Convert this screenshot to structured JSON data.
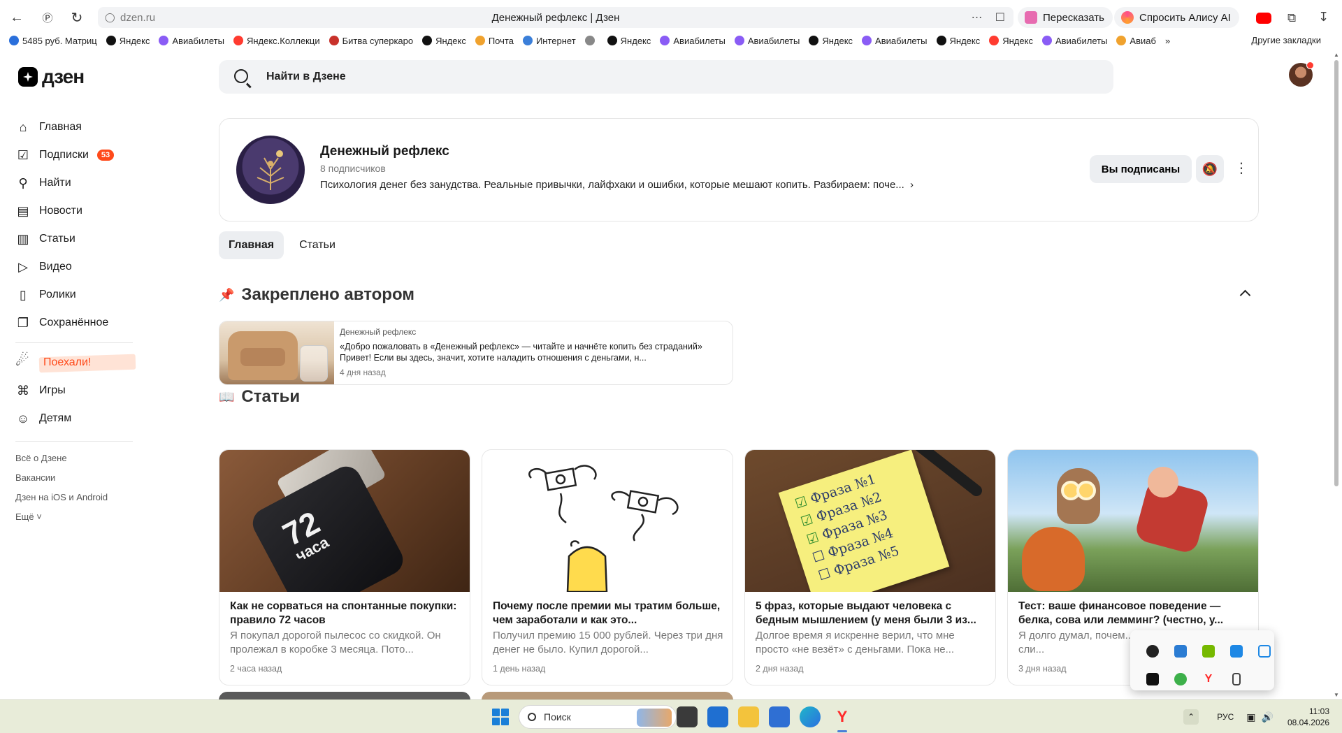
{
  "browser": {
    "url": "dzen.ru",
    "title": "Денежный рефлекс | Дзен",
    "retell_label": "Пересказать",
    "ask_alice_label": "Спросить Алису AI",
    "bookmarks": [
      {
        "label": "5485 руб. Матриц",
        "color": "#2a6fdb"
      },
      {
        "label": "Яндекс",
        "color": "#111111"
      },
      {
        "label": "Авиабилеты",
        "color": "#8a5cf5"
      },
      {
        "label": "Яндекс.Коллекци",
        "color": "#ff3b30"
      },
      {
        "label": "Битва суперкаро",
        "color": "#c8312b"
      },
      {
        "label": "Яндекс",
        "color": "#111111"
      },
      {
        "label": "Почта",
        "color": "#f0a22e"
      },
      {
        "label": "Интернет",
        "color": "#3b7fd9"
      },
      {
        "label": "",
        "color": "#888888"
      },
      {
        "label": "Яндекс",
        "color": "#111111"
      },
      {
        "label": "Авиабилеты",
        "color": "#8a5cf5"
      },
      {
        "label": "Авиабилеты",
        "color": "#8a5cf5"
      },
      {
        "label": "Яндекс",
        "color": "#111111"
      },
      {
        "label": "Авиабилеты",
        "color": "#8a5cf5"
      },
      {
        "label": "Яндекс",
        "color": "#111111"
      },
      {
        "label": "Яндекс",
        "color": "#ff3b30"
      },
      {
        "label": "Авиабилеты",
        "color": "#8a5cf5"
      },
      {
        "label": "Авиаб",
        "color": "#f0a22e"
      }
    ],
    "other_bookmarks": "Другие закладки"
  },
  "dzen": {
    "logo_text": "дзен",
    "search_placeholder": "Найти в Дзене",
    "sidebar": {
      "items": [
        {
          "label": "Главная",
          "icon": "home-icon"
        },
        {
          "label": "Подписки",
          "icon": "subscriptions-icon",
          "badge": "53"
        },
        {
          "label": "Найти",
          "icon": "search-icon"
        },
        {
          "label": "Новости",
          "icon": "news-icon"
        },
        {
          "label": "Статьи",
          "icon": "articles-icon"
        },
        {
          "label": "Видео",
          "icon": "video-icon"
        },
        {
          "label": "Ролики",
          "icon": "shorts-icon"
        },
        {
          "label": "Сохранённое",
          "icon": "bookmark-icon"
        }
      ],
      "promo_label": "Поехали!",
      "extra_items": [
        {
          "label": "Игры",
          "icon": "gamepad-icon"
        },
        {
          "label": "Детям",
          "icon": "kids-icon"
        }
      ],
      "footer_links": [
        "Всё о Дзене",
        "Вакансии",
        "Дзен на iOS и Android",
        "Ещё"
      ]
    },
    "channel": {
      "name": "Денежный рефлекс",
      "subscribers": "8 подписчиков",
      "description": "Психология денег без занудства. Реальные привычки, лайфхаки и ошибки, которые мешают копить. Разбираем: поче...",
      "subscribed_label": "Вы подписаны"
    },
    "tabs": [
      "Главная",
      "Статьи"
    ],
    "pinned": {
      "section_title": "Закреплено автором",
      "source": "Денежный рефлекс",
      "title": "«Добро пожаловать в «Денежный рефлекс» — читайте и начнёте копить без страданий» Привет! Если вы здесь, значит, хотите наладить отношения с деньгами, н...",
      "time": "4 дня назад"
    },
    "articles_section_title": "Статьи",
    "articles": [
      {
        "title": "Как не сорваться на спонтанные покупки: правило 72 часов",
        "snippet": "Я покупал дорогой пылесос со скидкой. Он пролежал в коробке 3 месяца. Пото...",
        "time": "2 часа назад",
        "image_text": "72",
        "image_subtext": "часа"
      },
      {
        "title": "Почему после премии мы тратим больше, чем заработали и как это...",
        "snippet": "Получил премию 15 000 рублей. Через три дня денег не было. Купил дорогой...",
        "time": "1 день назад"
      },
      {
        "title": "5 фраз, которые выдают человека с бедным мышлением (у меня были 3 из...",
        "snippet": "Долгое время я искренне верил, что мне просто «не везёт» с деньгами. Пока не...",
        "time": "2 дня назад",
        "note_lines": [
          "Фраза №1",
          "Фраза №2",
          "Фраза №3",
          "Фраза №4",
          "Фраза №5"
        ]
      },
      {
        "title": "Тест: ваше финансовое поведение — белка, сова или лемминг? (честно, у...",
        "snippet": "Я долго думал, почем... напряга, а другие сли...",
        "time": "3 дня назад"
      }
    ]
  },
  "taskbar": {
    "search_label": "Поиск",
    "language": "РУС",
    "time": "11:03",
    "date": "08.04.2026"
  }
}
